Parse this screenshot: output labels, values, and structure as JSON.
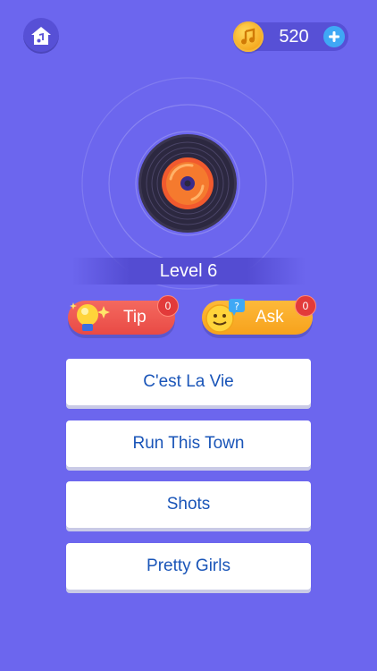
{
  "header": {
    "home_icon": "home-music-icon",
    "coins": "520",
    "coin_icon": "music-note-coin-icon",
    "add_icon": "plus-icon"
  },
  "level": {
    "title": "Level 6"
  },
  "hints": {
    "tip": {
      "label": "Tip",
      "count": "0",
      "icon": "lightbulb-icon"
    },
    "ask": {
      "label": "Ask",
      "count": "0",
      "icon": "emoji-question-icon"
    }
  },
  "answers": [
    "C'est La Vie",
    "Run This Town",
    "Shots",
    "Pretty Girls"
  ],
  "colors": {
    "background": "#6c66ee",
    "tip": "#ef5a54",
    "ask": "#f9ad2a",
    "answer_text": "#1a55b8"
  }
}
